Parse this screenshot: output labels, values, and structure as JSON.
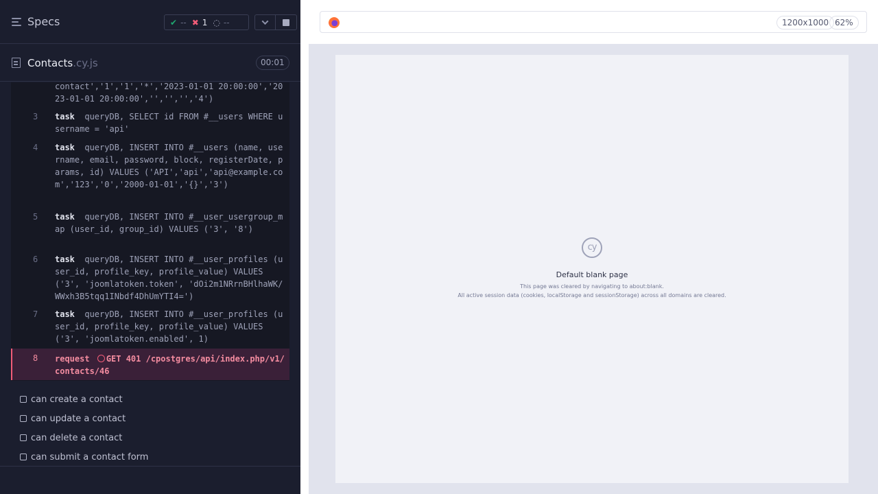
{
  "header": {
    "title": "Specs",
    "stats": {
      "passed": "--",
      "failed": "1",
      "pending": "--"
    }
  },
  "spec": {
    "name": "Contacts",
    "ext": ".cy.js",
    "duration": "00:01"
  },
  "commands": [
    {
      "num": "",
      "keyword": "",
      "text": "contact','1','1','*','2023-01-01 20:00:00','2023-01-01 20:00:00','','','','4')"
    },
    {
      "num": "3",
      "keyword": "task",
      "text": "queryDB, SELECT id FROM #__users WHERE username = 'api'"
    },
    {
      "num": "4",
      "keyword": "task",
      "text": "queryDB, INSERT INTO #__users (name, username, email, password, block, registerDate, params, id) VALUES ('API','api','api@example.com','123','0','2000-01-01','{}','3')"
    },
    {
      "num": "5",
      "keyword": "task",
      "text": "queryDB, INSERT INTO #__user_usergroup_map (user_id, group_id) VALUES ('3', '8')"
    },
    {
      "num": "6",
      "keyword": "task",
      "text": "queryDB, INSERT INTO #__user_profiles (user_id, profile_key, profile_value) VALUES ('3', 'joomlatoken.token', 'dOi2m1NRrnBHlhaWK/WWxh3B5tqq1INbdf4DhUmYTI4=')"
    },
    {
      "num": "7",
      "keyword": "task",
      "text": "queryDB, INSERT INTO #__user_profiles (user_id, profile_key, profile_value) VALUES ('3', 'joomlatoken.enabled', 1)"
    },
    {
      "num": "8",
      "keyword": "request",
      "text": "GET 401 /cpostgres/api/index.php/v1/contacts/46"
    }
  ],
  "tests": [
    "can create a contact",
    "can update a contact",
    "can delete a contact",
    "can submit a contact form"
  ],
  "aut": {
    "viewport": "1200x1000",
    "zoom": "62%",
    "logo_text": "cy",
    "blank_title": "Default blank page",
    "blank_line1": "This page was cleared by navigating to about:blank.",
    "blank_line2": "All active session data (cookies, localStorage and sessionStorage) across all domains are cleared."
  },
  "colors": {
    "pass": "#1fa971",
    "fail": "#f25c78",
    "panel_bg": "#1b1e2e"
  }
}
